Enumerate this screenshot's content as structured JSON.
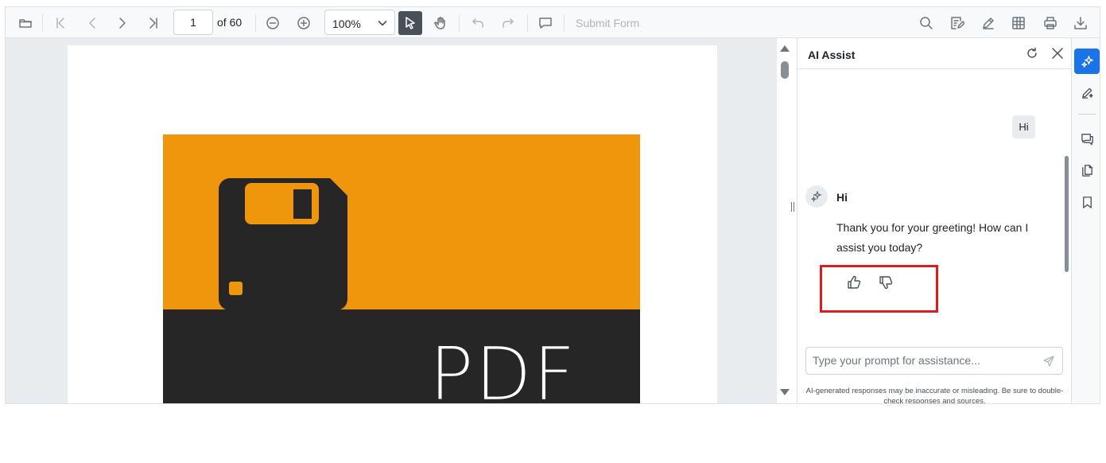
{
  "toolbar": {
    "page_number": "1",
    "page_total_label": "of 60",
    "zoom_value": "100%",
    "submit_form_label": "Submit Form"
  },
  "document": {
    "cover_text": "PDF",
    "colors": {
      "orange": "#ef960c",
      "dark": "#262626"
    }
  },
  "ai_assist": {
    "title": "AI Assist",
    "user_message": "Hi",
    "bot_prompt_echo": "Hi",
    "bot_response": "Thank you for your greeting! How can I assist you today?",
    "input_placeholder": "Type your prompt for assistance...",
    "disclaimer": "AI-generated responses may be inaccurate or misleading. Be sure to double-check responses and sources.",
    "highlight_color": "#e01b1b"
  },
  "sidebar": {
    "items": [
      "ai-assist-icon",
      "ai-edit-icon",
      "comments-icon",
      "pages-icon",
      "bookmark-icon"
    ],
    "active_color": "#1a73e8"
  }
}
